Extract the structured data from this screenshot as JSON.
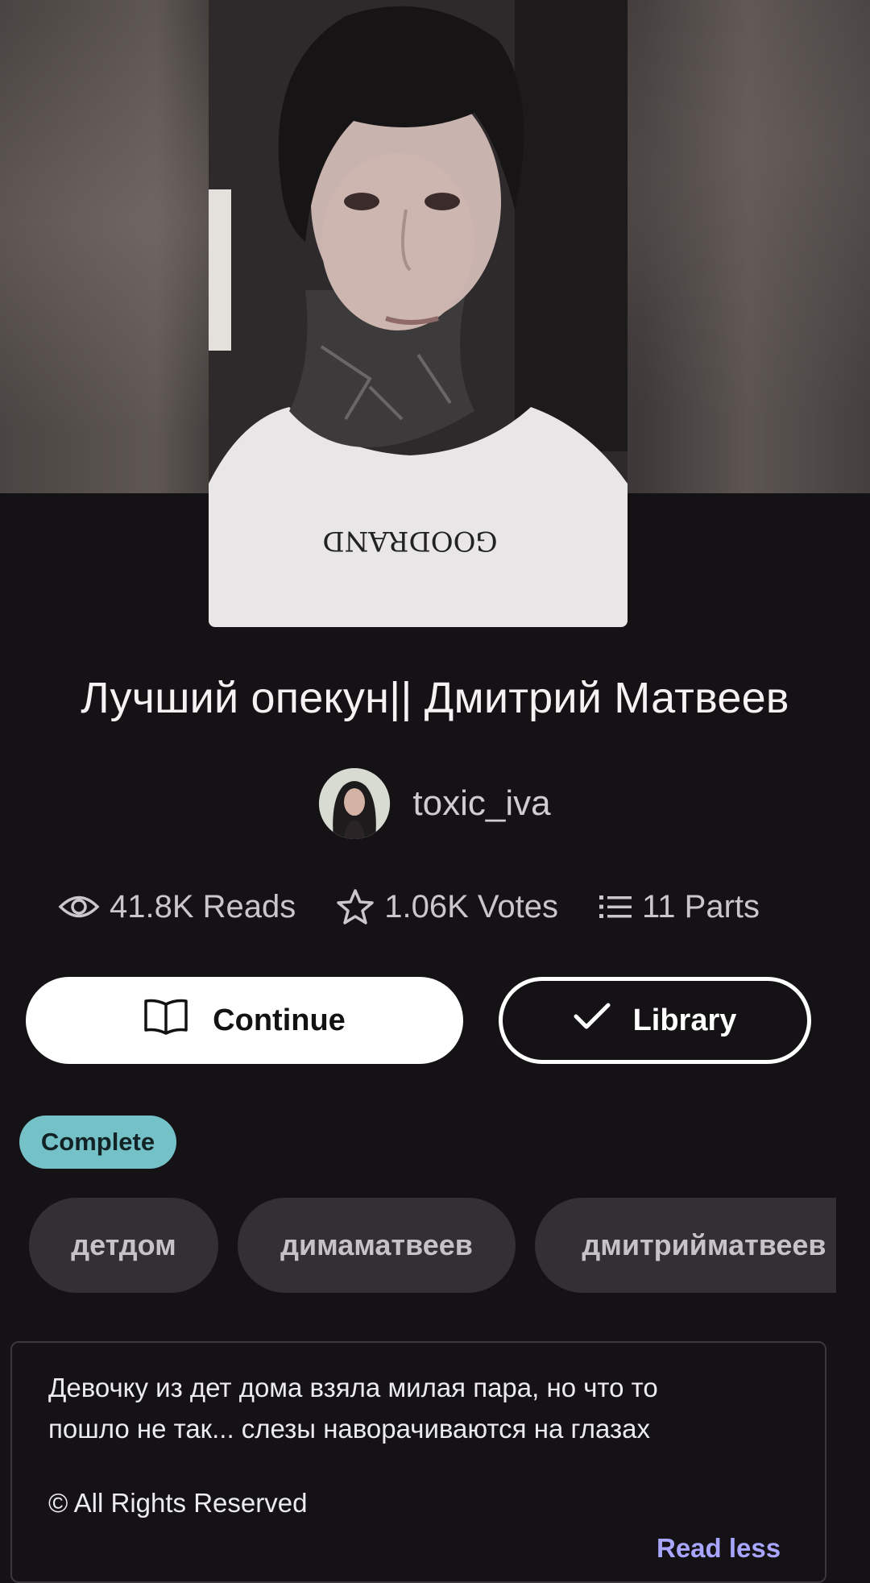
{
  "story": {
    "title": "Лучший опекун|| Дмитрий Матвеев",
    "author": "toxic_iva",
    "cover_print": "GOODRAND"
  },
  "stats": {
    "reads": "41.8K Reads",
    "votes": "1.06K Votes",
    "parts": "11 Parts"
  },
  "actions": {
    "continue_label": "Continue",
    "library_label": "Library"
  },
  "status_badge": "Complete",
  "tags": [
    "детдом",
    "димаматвеев",
    "дмитрийматвеев"
  ],
  "description": {
    "line1": "Девочку из дет дома взяла милая пара, но что то",
    "line2": "пошло не так... слезы наворачиваются на глазах",
    "rights": "© All Rights Reserved",
    "toggle": "Read less"
  },
  "icons": [
    "eye-icon",
    "star-icon",
    "list-icon",
    "book-icon",
    "check-icon"
  ],
  "colors": {
    "background": "#141215",
    "badge": "#74c1c8",
    "tag_bg": "#323034",
    "link": "#a8a6ff"
  }
}
